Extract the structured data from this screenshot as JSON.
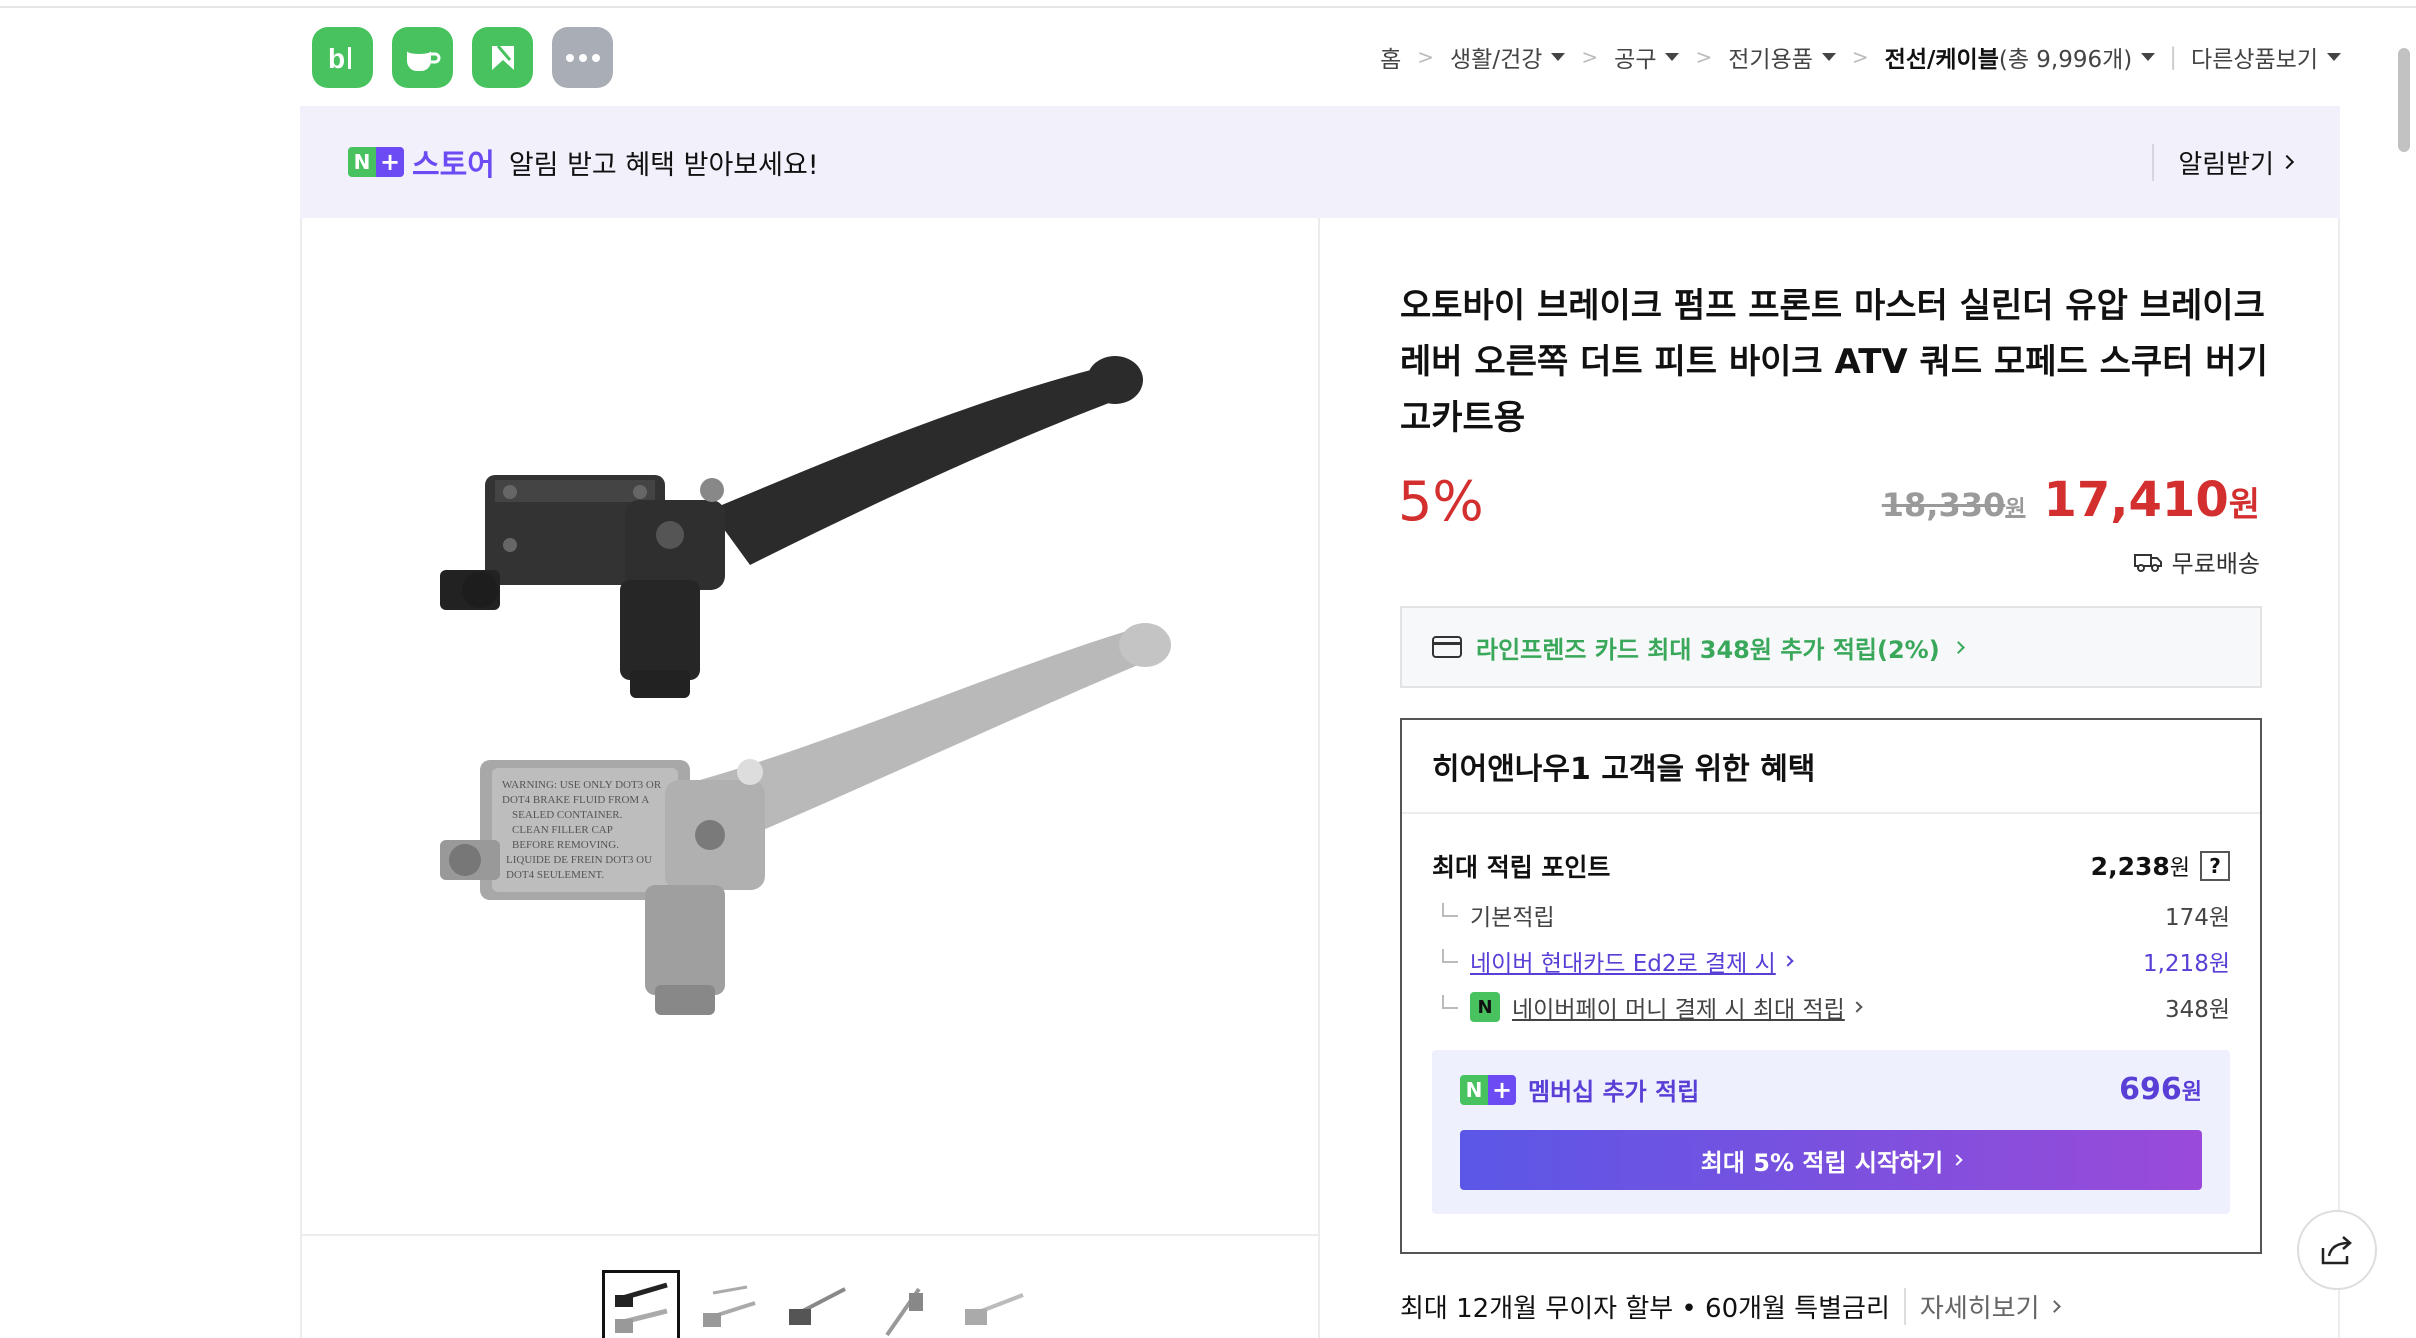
{
  "app_icons": [
    {
      "name": "blog-app",
      "glyph": "b|",
      "color": "#47c25f"
    },
    {
      "name": "cafe-app",
      "glyph": "cafe",
      "color": "#47c25f"
    },
    {
      "name": "webtoon-app",
      "glyph": "K",
      "color": "#47c25f"
    },
    {
      "name": "more-apps",
      "glyph": "•••",
      "color": "#a9adb6"
    }
  ],
  "breadcrumb": {
    "home": "홈",
    "items": [
      "생활/건강",
      "공구",
      "전기용품"
    ],
    "current_label": "전선/케이블",
    "current_count": "(총 9,996개)",
    "other": "다른상품보기"
  },
  "banner": {
    "store_label": "스토어",
    "message": "알림 받고 혜택 받아보세요!",
    "alarm": "알림받기"
  },
  "product": {
    "title": "오토바이 브레이크 펌프 프론트 마스터 실린더 유압 브레이크 레버 오른쪽 더트 피트 바이크 ATV 쿼드 모페드 스쿠터 버기 고카트용",
    "discount": "5%",
    "original_price": "18,330",
    "sale_price": "17,410",
    "currency": "원",
    "shipping": "무료배송",
    "card_benefit": "라인프렌즈 카드 최대 348원 추가 적립(2%)"
  },
  "benefits": {
    "heading": "히어앤나우1 고객을 위한 혜택",
    "max_points_label": "최대 적립 포인트",
    "max_points_value": "2,238",
    "help": "?",
    "rows": [
      {
        "label": "기본적립",
        "value": "174원"
      },
      {
        "label": "네이버 현대카드 Ed2로 결제 시",
        "value": "1,218원"
      },
      {
        "label": "네이버페이 머니 결제 시 최대 적립",
        "value": "348원"
      }
    ],
    "membership_label": "멤버십 추가 적립",
    "membership_value": "696",
    "cta": "최대 5% 적립 시작하기"
  },
  "installment": {
    "text": "최대 12개월 무이자 할부 • 60개월 특별금리",
    "more": "자세히보기"
  },
  "colors": {
    "naver_green": "#47c25f",
    "store_purple": "#6c4bf5",
    "price_red": "#d32f2f"
  }
}
